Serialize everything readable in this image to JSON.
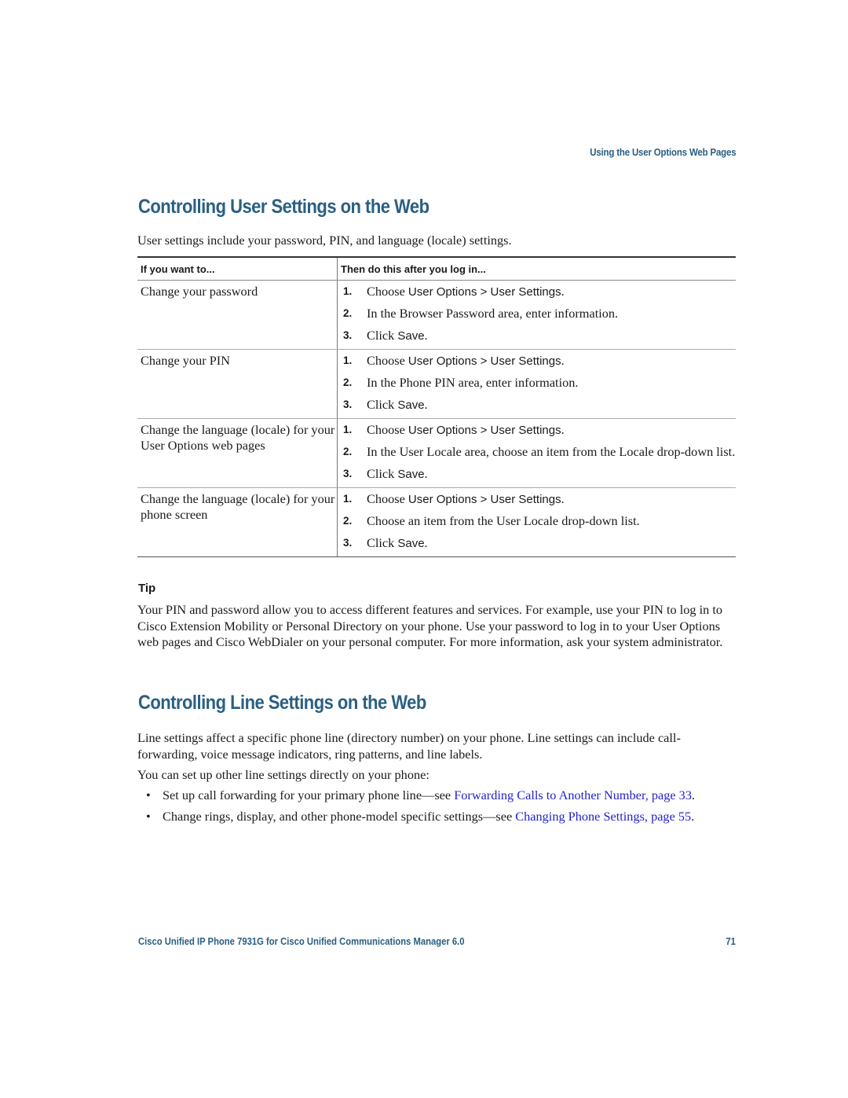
{
  "running_head": "Using the User Options Web Pages",
  "section1": {
    "title": "Controlling User Settings on the Web",
    "intro": "User settings include your password, PIN, and language (locale) settings.",
    "table": {
      "headers": [
        "If you want to...",
        "Then do this after you log in..."
      ],
      "rows": [
        {
          "task": "Change your password",
          "steps": [
            {
              "num": "1.",
              "pre": "Choose ",
              "ui": "User Options > User Settings",
              "post": "."
            },
            {
              "num": "2.",
              "pre": "In the Browser Password area, enter information.",
              "ui": "",
              "post": ""
            },
            {
              "num": "3.",
              "pre": "Click ",
              "ui": "Save",
              "post": "."
            }
          ]
        },
        {
          "task": "Change your PIN",
          "steps": [
            {
              "num": "1.",
              "pre": "Choose ",
              "ui": "User Options > User Settings",
              "post": "."
            },
            {
              "num": "2.",
              "pre": "In the Phone PIN area, enter information.",
              "ui": "",
              "post": ""
            },
            {
              "num": "3.",
              "pre": "Click ",
              "ui": "Save",
              "post": "."
            }
          ]
        },
        {
          "task": "Change the language (locale) for your User Options web pages",
          "steps": [
            {
              "num": "1.",
              "pre": "Choose ",
              "ui": "User Options > User Settings",
              "post": "."
            },
            {
              "num": "2.",
              "pre": "In the User Locale area, choose an item from the Locale drop-down list.",
              "ui": "",
              "post": ""
            },
            {
              "num": "3.",
              "pre": "Click ",
              "ui": "Save",
              "post": "."
            }
          ]
        },
        {
          "task": "Change the language (locale) for your phone screen",
          "steps": [
            {
              "num": "1.",
              "pre": "Choose ",
              "ui": "User Options > User Settings",
              "post": "."
            },
            {
              "num": "2.",
              "pre": "Choose an item from the User Locale drop-down list.",
              "ui": "",
              "post": ""
            },
            {
              "num": "3.",
              "pre": "Click ",
              "ui": "Save",
              "post": "."
            }
          ]
        }
      ]
    }
  },
  "tip": {
    "label": "Tip",
    "text": "Your PIN and password allow you to access different features and services. For example, use your PIN to log in to Cisco Extension Mobility or Personal Directory on your phone. Use your password to log in to your User Options web pages and Cisco WebDialer on your personal computer. For more information, ask your system administrator."
  },
  "section2": {
    "title": "Controlling Line Settings on the Web",
    "para1": "Line settings affect a specific phone line (directory number) on your phone. Line settings can include call-forwarding, voice message indicators, ring patterns, and line labels.",
    "para2": "You can set up other line settings directly on your phone:",
    "bullets": [
      {
        "text": "Set up call forwarding for your primary phone line—see ",
        "link": "Forwarding Calls to Another Number, page 33",
        "after": "."
      },
      {
        "text": "Change rings, display, and other phone-model specific settings—see ",
        "link": "Changing Phone Settings, page 55",
        "after": "."
      }
    ]
  },
  "footer": {
    "title": "Cisco Unified IP Phone 7931G for Cisco Unified Communications Manager 6.0",
    "page": "71"
  },
  "colors": {
    "heading": "#2a5f82",
    "link": "#2222cc"
  }
}
